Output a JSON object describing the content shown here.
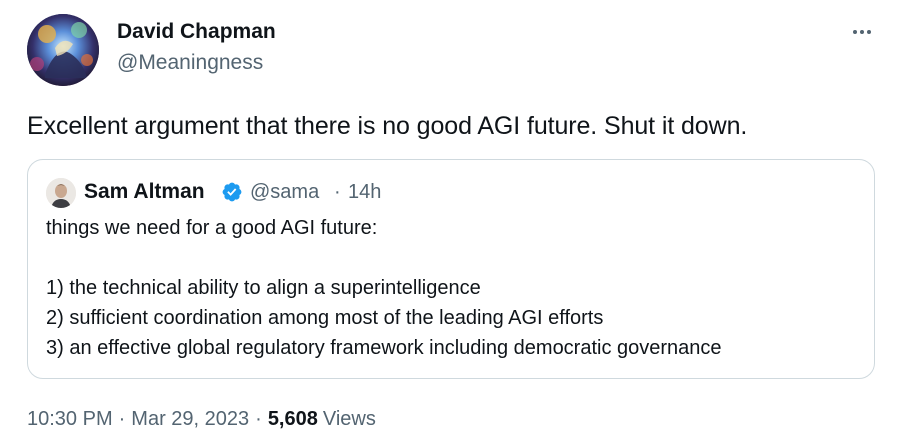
{
  "tweet": {
    "author": {
      "name": "David Chapman",
      "handle": "@Meaningness"
    },
    "text": "Excellent argument that there is no good AGI future. Shut it down.",
    "more_icon": "more-horizontal-icon",
    "quote": {
      "author_name": "Sam Altman",
      "verified_icon": "verified-badge-icon",
      "verified_color": "#1d9bf0",
      "handle": "@sama",
      "separator": "·",
      "time": "14h",
      "lines": [
        "things we need for a good AGI future:",
        "1) the technical ability to align a superintelligence",
        "2) sufficient coordination among most of the leading AGI efforts",
        "3) an effective global regulatory framework including democratic governance"
      ]
    },
    "meta": {
      "time": "10:30 PM",
      "separator": "·",
      "date": "Mar 29, 2023",
      "views_count": "5,608",
      "views_label": "Views"
    }
  },
  "colors": {
    "text_primary": "#0f1419",
    "text_secondary": "#536471",
    "border": "#cfd9de",
    "verified_blue": "#1d9bf0"
  }
}
